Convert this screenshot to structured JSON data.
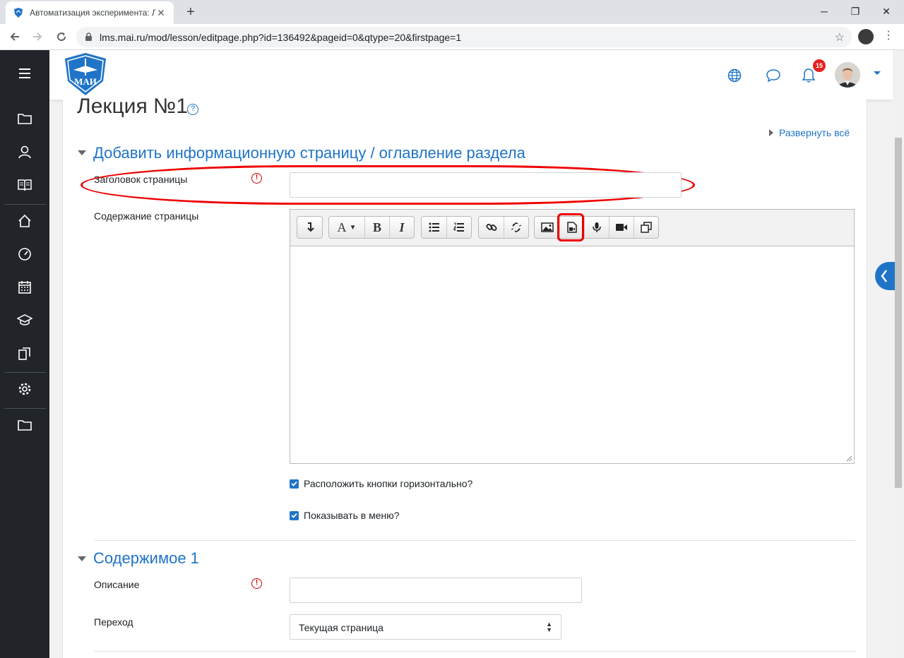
{
  "browser": {
    "tab_title": "Автоматизация эксперимента: Л",
    "close_tab": "✕",
    "new_tab": "+",
    "url": "lms.mai.ru/mod/lesson/editpage.php?id=136492&pageid=0&qtype=20&firstpage=1",
    "minimize": "─",
    "restore": "❐",
    "close": "✕"
  },
  "sidebar": {
    "items": [
      "menu-icon",
      "folder-icon",
      "user-icon",
      "book-icon",
      "home-icon",
      "dashboard-icon",
      "calendar-icon",
      "graduation-icon",
      "files-icon",
      "settings-icon",
      "folder-icon"
    ]
  },
  "header": {
    "logo_text": "МАИ",
    "notification_count": "15"
  },
  "page": {
    "title": "Лекция №1",
    "help": "?",
    "expand_all": "Развернуть всё"
  },
  "section1": {
    "title": "Добавить информационную страницу / оглавление раздела",
    "page_title_label": "Заголовок страницы",
    "page_title_value": "",
    "content_label": "Содержание страницы",
    "required_mark": "!",
    "checkbox_horizontal": "Расположить кнопки горизонтально?",
    "checkbox_menu": "Показывать в меню?"
  },
  "section2": {
    "title": "Содержимое 1",
    "description_label": "Описание",
    "description_value": "",
    "jump_label": "Переход",
    "jump_value": "Текущая страница"
  },
  "editor_toolbar": {
    "groups": [
      [
        "collapse-icon"
      ],
      [
        "font-style-icon",
        "bold-icon",
        "italic-icon"
      ],
      [
        "unordered-list-icon",
        "ordered-list-icon"
      ],
      [
        "link-icon",
        "unlink-icon"
      ],
      [
        "image-icon",
        "media-icon",
        "record-audio-icon",
        "record-video-icon",
        "manage-files-icon"
      ]
    ],
    "bold": "B",
    "italic": "I",
    "font": "A"
  },
  "colors": {
    "accent": "#1f74c7",
    "sidebar": "#212529",
    "highlight": "#e00000"
  }
}
